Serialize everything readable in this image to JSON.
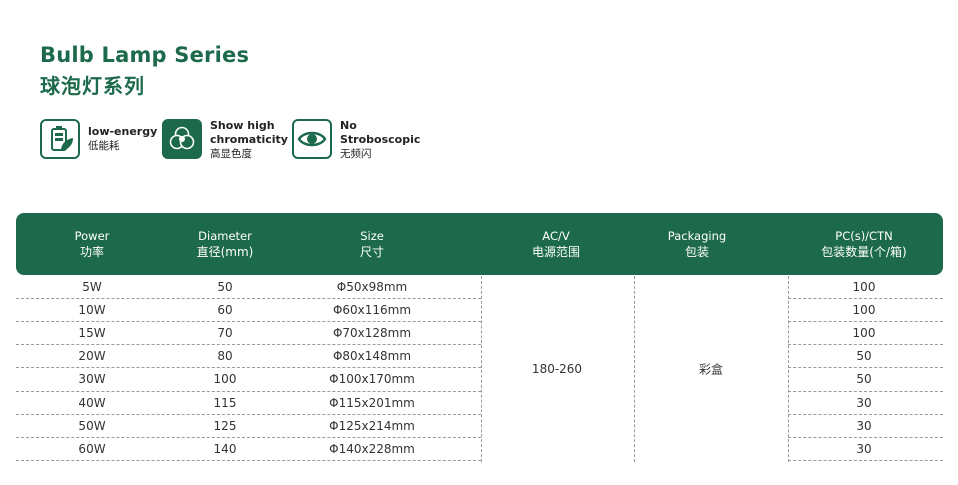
{
  "title": {
    "en": "Bulb Lamp Series",
    "cn": "球泡灯系列"
  },
  "features": [
    {
      "icon": "battery-leaf-icon",
      "en": "low-energy",
      "cn": "低能耗"
    },
    {
      "icon": "color-circles-icon",
      "en_line1": "Show high",
      "en_line2": "chromaticity",
      "cn": "高显色度"
    },
    {
      "icon": "eye-icon",
      "en_line1": "No",
      "en_line2": "Stroboscopic",
      "cn": "无频闪"
    }
  ],
  "table": {
    "headers": [
      {
        "en": "Power",
        "cn": "功率"
      },
      {
        "en": "Diameter",
        "cn": "直径(mm)"
      },
      {
        "en": "Size",
        "cn": "尺寸"
      },
      {
        "en": "AC/V",
        "cn": "电源范围"
      },
      {
        "en": "Packaging",
        "cn": "包装"
      },
      {
        "en": "PC(s)/CTN",
        "cn": "包装数量(个/箱)"
      }
    ],
    "rows": [
      {
        "power": "5W",
        "diameter": "50",
        "size": "Φ50x98mm",
        "pcs": "100"
      },
      {
        "power": "10W",
        "diameter": "60",
        "size": "Φ60x116mm",
        "pcs": "100"
      },
      {
        "power": "15W",
        "diameter": "70",
        "size": "Φ70x128mm",
        "pcs": "100"
      },
      {
        "power": "20W",
        "diameter": "80",
        "size": "Φ80x148mm",
        "pcs": "50"
      },
      {
        "power": "30W",
        "diameter": "100",
        "size": "Φ100x170mm",
        "pcs": "50"
      },
      {
        "power": "40W",
        "diameter": "115",
        "size": "Φ115x201mm",
        "pcs": "30"
      },
      {
        "power": "50W",
        "diameter": "125",
        "size": "Φ125x214mm",
        "pcs": "30"
      },
      {
        "power": "60W",
        "diameter": "140",
        "size": "Φ140x228mm",
        "pcs": "30"
      }
    ],
    "ac_v": "180-260",
    "packaging": "彩盒"
  },
  "colors": {
    "brand_green": "#1c6a4b"
  }
}
